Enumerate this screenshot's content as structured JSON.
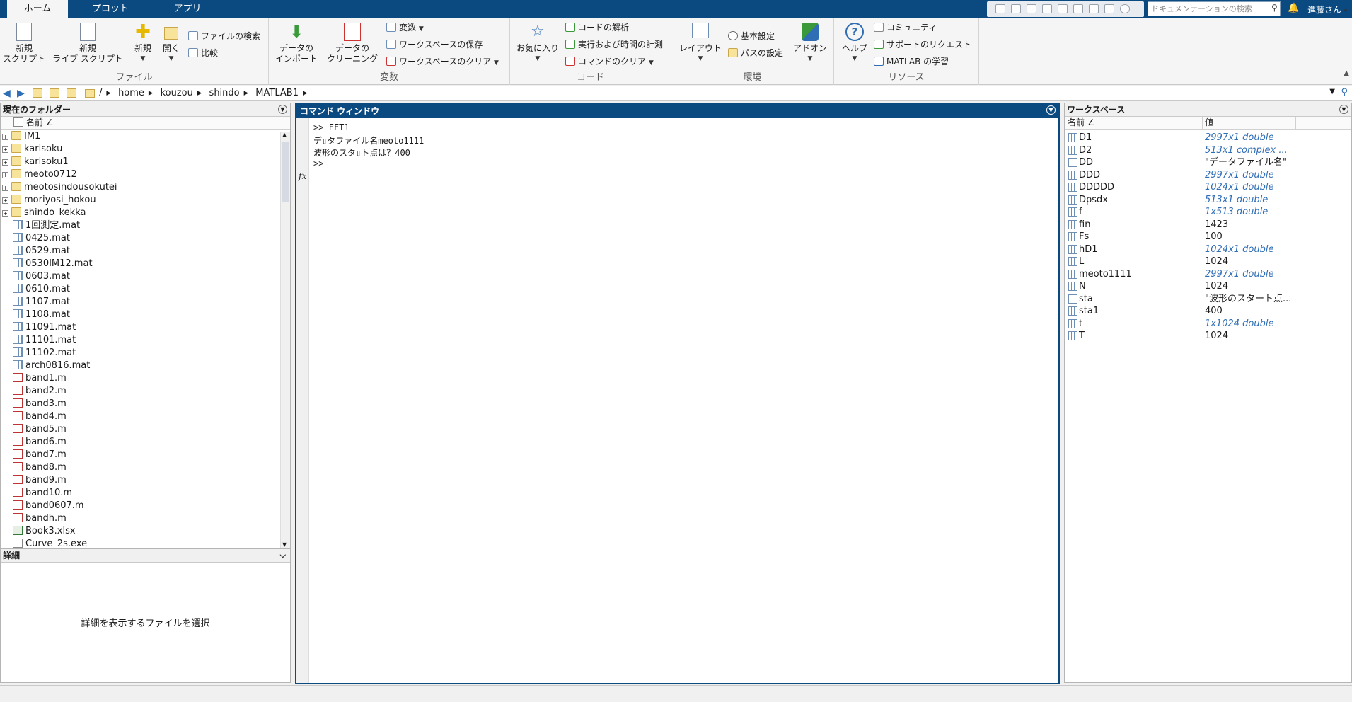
{
  "tabs": [
    {
      "label": "ホーム",
      "active": true
    },
    {
      "label": "プロット",
      "active": false
    },
    {
      "label": "アプリ",
      "active": false
    }
  ],
  "doc_search_placeholder": "ドキュメンテーションの検索",
  "user_label": "進藤さん",
  "ribbon": {
    "file": {
      "label": "ファイル",
      "new_script": [
        "新規",
        "スクリプト"
      ],
      "new_live_script": [
        "新規",
        "ライブ スクリプト"
      ],
      "new": "新規",
      "open": "開く",
      "find_files": "ファイルの検索",
      "compare": "比較"
    },
    "variable": {
      "label": "変数",
      "import_data": [
        "データの",
        "インポート"
      ],
      "clean_data": [
        "データの",
        "クリーニング"
      ],
      "variable": "変数",
      "save_workspace": "ワークスペースの保存",
      "clear_workspace": "ワークスペースのクリア"
    },
    "code": {
      "label": "コード",
      "favorites": "お気に入り",
      "analyze_code": "コードの解析",
      "run_and_time": "実行および時間の計測",
      "clear_commands": "コマンドのクリア"
    },
    "environment": {
      "label": "環境",
      "layout": "レイアウト",
      "preferences": "基本設定",
      "set_path": "パスの設定",
      "addons": "アドオン"
    },
    "resources": {
      "label": "リソース",
      "help": "ヘルプ",
      "community": "コミュニティ",
      "request_support": "サポートのリクエスト",
      "learn_matlab": "MATLAB の学習"
    }
  },
  "address": {
    "path": [
      "/",
      "home",
      "kouzou",
      "shindo",
      "MATLAB1"
    ]
  },
  "current_folder": {
    "title": "現在のフォルダー",
    "column_name": "名前 ∠",
    "items": [
      {
        "name": "IM1",
        "type": "folder"
      },
      {
        "name": "karisoku",
        "type": "folder"
      },
      {
        "name": "karisoku1",
        "type": "folder"
      },
      {
        "name": "meoto0712",
        "type": "folder"
      },
      {
        "name": "meotosindousokutei",
        "type": "folder"
      },
      {
        "name": "moriyosi_hokou",
        "type": "folder"
      },
      {
        "name": "shindo_kekka",
        "type": "folder"
      },
      {
        "name": "1回測定.mat",
        "type": "mat"
      },
      {
        "name": "0425.mat",
        "type": "mat"
      },
      {
        "name": "0529.mat",
        "type": "mat"
      },
      {
        "name": "0530IM12.mat",
        "type": "mat"
      },
      {
        "name": "0603.mat",
        "type": "mat"
      },
      {
        "name": "0610.mat",
        "type": "mat"
      },
      {
        "name": "1107.mat",
        "type": "mat"
      },
      {
        "name": "1108.mat",
        "type": "mat"
      },
      {
        "name": "11091.mat",
        "type": "mat"
      },
      {
        "name": "11101.mat",
        "type": "mat"
      },
      {
        "name": "11102.mat",
        "type": "mat"
      },
      {
        "name": "arch0816.mat",
        "type": "mat"
      },
      {
        "name": "band1.m",
        "type": "m"
      },
      {
        "name": "band2.m",
        "type": "m"
      },
      {
        "name": "band3.m",
        "type": "m"
      },
      {
        "name": "band4.m",
        "type": "m"
      },
      {
        "name": "band5.m",
        "type": "m"
      },
      {
        "name": "band6.m",
        "type": "m"
      },
      {
        "name": "band7.m",
        "type": "m"
      },
      {
        "name": "band8.m",
        "type": "m"
      },
      {
        "name": "band9.m",
        "type": "m"
      },
      {
        "name": "band10.m",
        "type": "m"
      },
      {
        "name": "band0607.m",
        "type": "m"
      },
      {
        "name": "bandh.m",
        "type": "m"
      },
      {
        "name": "Book3.xlsx",
        "type": "xlsx"
      },
      {
        "name": "Curve_2s.exe",
        "type": "gen"
      }
    ]
  },
  "details": {
    "title": "詳細",
    "message": "詳細を表示するファイルを選択"
  },
  "command_window": {
    "title": "コマンド ウィンドウ",
    "lines": [
      ">> FFT1",
      "デ▯タファイル名meoto1111",
      "波形のスタ▯ト点は？400",
      ">>"
    ],
    "fx": "fx"
  },
  "workspace": {
    "title": "ワークスペース",
    "col_name": "名前 ∠",
    "col_value": "値",
    "vars": [
      {
        "name": "D1",
        "value": "2997x1 double",
        "italic": true,
        "kind": "num"
      },
      {
        "name": "D2",
        "value": "513x1 complex ...",
        "italic": true,
        "kind": "num"
      },
      {
        "name": "DD",
        "value": "\"データファイル名\"",
        "italic": false,
        "kind": "str"
      },
      {
        "name": "DDD",
        "value": "2997x1 double",
        "italic": true,
        "kind": "num"
      },
      {
        "name": "DDDDD",
        "value": "1024x1 double",
        "italic": true,
        "kind": "num"
      },
      {
        "name": "Dpsdx",
        "value": "513x1 double",
        "italic": true,
        "kind": "num"
      },
      {
        "name": "f",
        "value": "1x513 double",
        "italic": true,
        "kind": "num"
      },
      {
        "name": "fin",
        "value": "1423",
        "italic": false,
        "kind": "num"
      },
      {
        "name": "Fs",
        "value": "100",
        "italic": false,
        "kind": "num"
      },
      {
        "name": "hD1",
        "value": "1024x1 double",
        "italic": true,
        "kind": "num"
      },
      {
        "name": "L",
        "value": "1024",
        "italic": false,
        "kind": "num"
      },
      {
        "name": "meoto1111",
        "value": "2997x1 double",
        "italic": true,
        "kind": "num"
      },
      {
        "name": "N",
        "value": "1024",
        "italic": false,
        "kind": "num"
      },
      {
        "name": "sta",
        "value": "\"波形のスタート点...",
        "italic": false,
        "kind": "str"
      },
      {
        "name": "sta1",
        "value": "400",
        "italic": false,
        "kind": "num"
      },
      {
        "name": "t",
        "value": "1x1024 double",
        "italic": true,
        "kind": "num"
      },
      {
        "name": "T",
        "value": "1024",
        "italic": false,
        "kind": "num"
      }
    ]
  }
}
